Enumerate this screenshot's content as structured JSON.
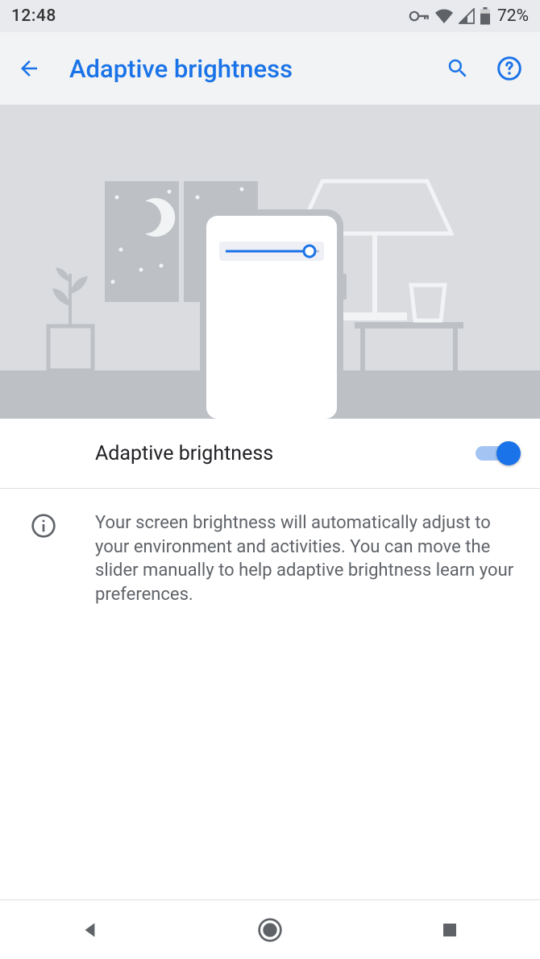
{
  "status": {
    "time": "12:48",
    "battery": "72%"
  },
  "header": {
    "title": "Adaptive brightness"
  },
  "setting": {
    "label": "Adaptive brightness",
    "enabled": true
  },
  "info": {
    "text": "Your screen brightness will automatically adjust to your environment and activities. You can move the slider manually to help adaptive brightness learn your preferences."
  }
}
